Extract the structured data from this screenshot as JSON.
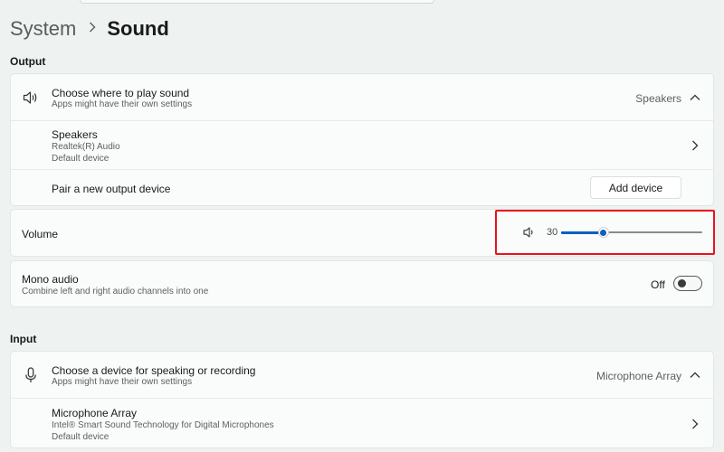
{
  "breadcrumb": {
    "parent": "System",
    "current": "Sound"
  },
  "output": {
    "section_label": "Output",
    "choose": {
      "title": "Choose where to play sound",
      "subtitle": "Apps might have their own settings",
      "value": "Speakers",
      "icon": "speaker-icon",
      "expanded": true
    },
    "device": {
      "name": "Speakers",
      "driver": "Realtek(R) Audio",
      "status": "Default device",
      "icon": "chevron-right-icon"
    },
    "pair": {
      "title": "Pair a new output device",
      "button_label": "Add device"
    }
  },
  "volume": {
    "label": "Volume",
    "value": "30",
    "level_percent": 30,
    "icon": "speaker-icon"
  },
  "mono": {
    "title": "Mono audio",
    "subtitle": "Combine left and right audio channels into one",
    "state_label": "Off",
    "enabled": false
  },
  "input": {
    "section_label": "Input",
    "choose": {
      "title": "Choose a device for speaking or recording",
      "subtitle": "Apps might have their own settings",
      "value": "Microphone Array",
      "icon": "microphone-icon",
      "expanded": true
    },
    "device": {
      "name": "Microphone Array",
      "driver": "Intel® Smart Sound Technology for Digital Microphones",
      "status": "Default device",
      "icon": "chevron-right-icon"
    }
  },
  "colors": {
    "accent": "#0a5fbf",
    "highlight": "#e8141c",
    "background": "#eef2f1"
  }
}
